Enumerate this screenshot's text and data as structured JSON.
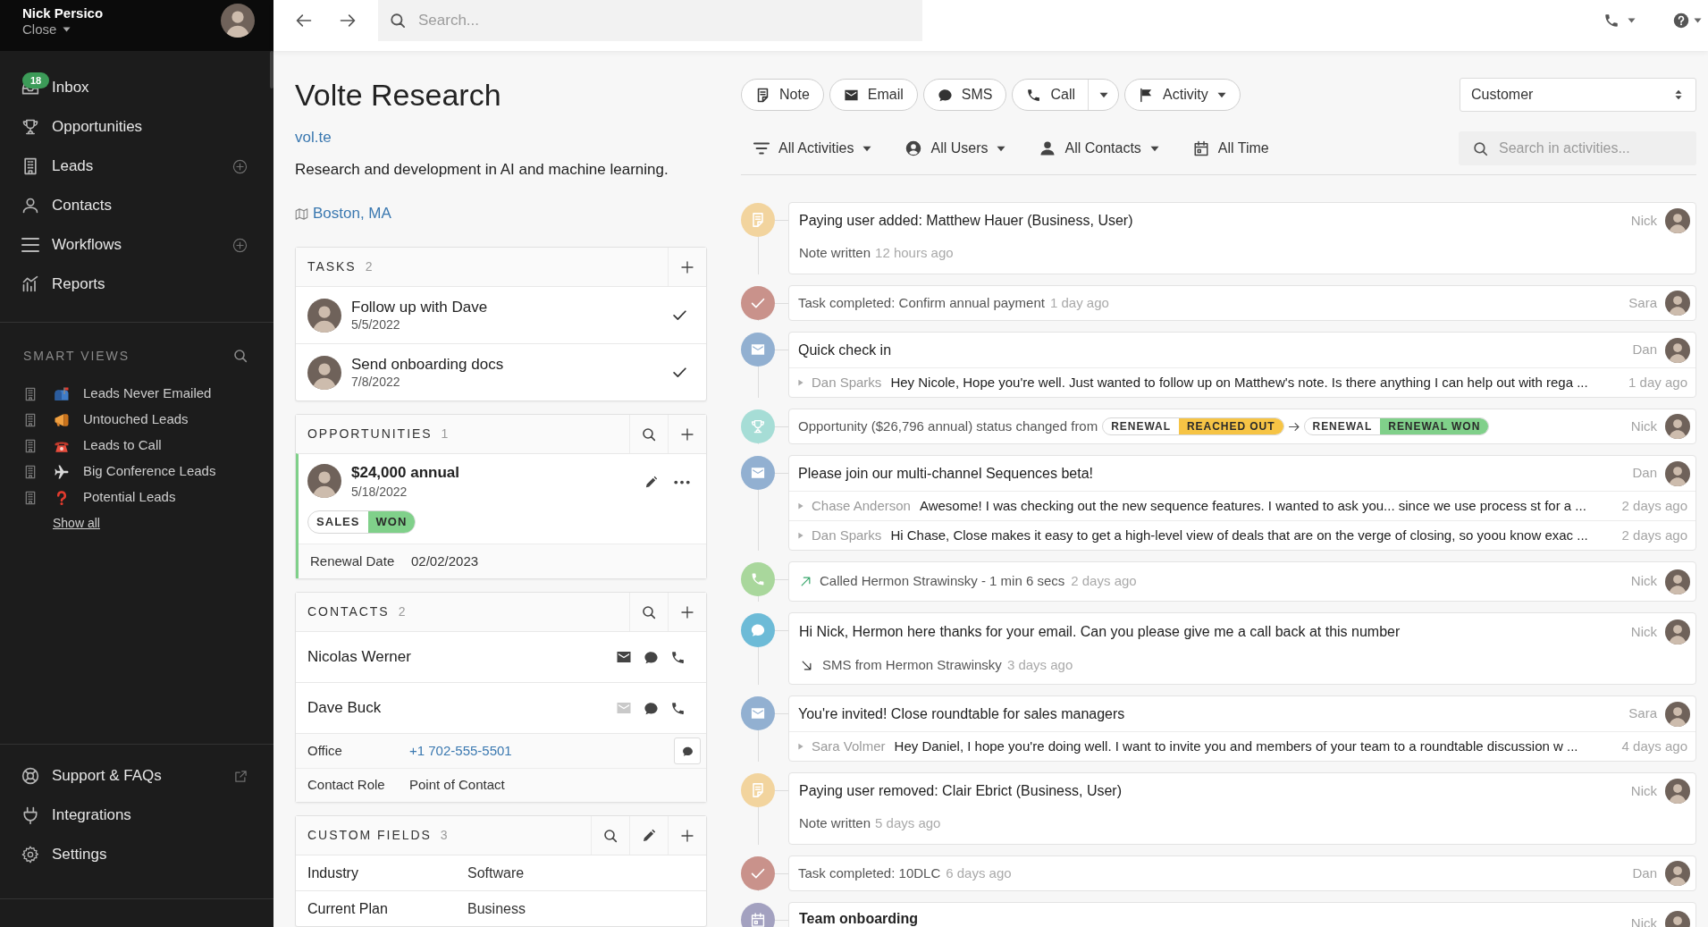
{
  "sidebar": {
    "user": {
      "name": "Nick Persico",
      "org": "Close"
    },
    "nav": [
      {
        "label": "Inbox",
        "kind": "inbox",
        "badge": "18",
        "has_add": false
      },
      {
        "label": "Opportunities",
        "kind": "trophy",
        "has_add": false
      },
      {
        "label": "Leads",
        "kind": "building",
        "has_add": true
      },
      {
        "label": "Contacts",
        "kind": "person",
        "has_add": false
      },
      {
        "label": "Workflows",
        "kind": "list",
        "has_add": true
      },
      {
        "label": "Reports",
        "kind": "chart",
        "has_add": false
      }
    ],
    "smart_views": {
      "title": "SMART VIEWS",
      "items": [
        {
          "label": "Leads Never Emailed",
          "kind": "mailbox"
        },
        {
          "label": "Untouched Leads",
          "kind": "megaphone"
        },
        {
          "label": "Leads to Call",
          "kind": "telephone"
        },
        {
          "label": "Big Conference Leads",
          "kind": "airplane"
        },
        {
          "label": "Potential Leads",
          "kind": "question"
        }
      ],
      "show_all": "Show all"
    },
    "footer": [
      {
        "label": "Support & FAQs",
        "kind": "lifebuoy",
        "external": true
      },
      {
        "label": "Integrations",
        "kind": "plug",
        "external": false
      },
      {
        "label": "Settings",
        "kind": "gear",
        "external": false
      }
    ]
  },
  "top_bar": {
    "search": {
      "placeholder": "Search..."
    }
  },
  "lead": {
    "name": "Volte Research",
    "url": "vol.te",
    "description": "Research and development in AI and machine learning.",
    "location": "Boston, MA"
  },
  "tasks": {
    "title": "TASKS",
    "count": "2",
    "actions": [
      {
        "kind": "add"
      }
    ],
    "items": [
      {
        "title": "Follow up with Dave",
        "date": "5/5/2022"
      },
      {
        "title": "Send onboarding docs",
        "date": "7/8/2022"
      }
    ]
  },
  "opportunities": {
    "title": "OPPORTUNITIES",
    "count": "1",
    "actions": [
      {
        "kind": "search"
      },
      {
        "kind": "add"
      }
    ],
    "items": [
      {
        "value": "$24,000 annual",
        "date": "5/18/2022",
        "pipeline": "SALES",
        "status": "WON",
        "color": "#80d08a",
        "fields": [
          {
            "label": "Renewal Date",
            "value": "02/02/2023"
          }
        ]
      }
    ]
  },
  "contacts": {
    "title": "CONTACTS",
    "count": "2",
    "actions": [
      {
        "kind": "search"
      },
      {
        "kind": "add"
      }
    ],
    "items": [
      {
        "name": "Nicolas Werner",
        "has_email": true
      },
      {
        "name": "Dave Buck",
        "has_email": false,
        "details": [
          {
            "label": "Office",
            "value": "+1 702-555-5501",
            "kind": "phone"
          },
          {
            "label": "Contact Role",
            "value": "Point of Contact",
            "kind": "text"
          }
        ]
      }
    ]
  },
  "custom_fields": {
    "title": "CUSTOM FIELDS",
    "count": "3",
    "actions": [
      {
        "kind": "search"
      },
      {
        "kind": "edit"
      },
      {
        "kind": "add"
      }
    ],
    "items": [
      {
        "label": "Industry",
        "value": "Software"
      },
      {
        "label": "Current Plan",
        "value": "Business"
      }
    ]
  },
  "composer": [
    {
      "label": "Note",
      "kind": "note"
    },
    {
      "label": "Email",
      "kind": "email"
    },
    {
      "label": "SMS",
      "kind": "sms"
    },
    {
      "label": "Call",
      "kind": "call",
      "menu": {
        "kind": "split"
      }
    },
    {
      "label": "Activity",
      "kind": "flag",
      "menu": {
        "kind": "inline"
      }
    }
  ],
  "lead_status": {
    "value": "Customer"
  },
  "filters": [
    {
      "label": "All Activities",
      "kind": "filter",
      "caret": true
    },
    {
      "label": "All Users",
      "kind": "user",
      "caret": true
    },
    {
      "label": "All Contacts",
      "kind": "person",
      "caret": true
    },
    {
      "label": "All Time",
      "kind": "calendar",
      "caret": false
    }
  ],
  "activity_search": {
    "placeholder": "Search in activities..."
  },
  "activities": [
    {
      "kind": "note",
      "title": "Paying user added: Matthew Hauer (Business, User)",
      "subtitle": "Note written",
      "time": "12 hours ago",
      "user": "Nick"
    },
    {
      "kind": "task",
      "title": "Task completed: Confirm annual payment",
      "time": "1 day ago",
      "user": "Sara"
    },
    {
      "kind": "email",
      "title": "Quick check in",
      "user": "Dan",
      "messages": [
        {
          "sender": "Dan Sparks",
          "text": "Hey Nicole, Hope you're well. Just wanted to follow up on Matthew's note. Is there anything I can help out with rega ...",
          "time": "1 day ago"
        }
      ]
    },
    {
      "kind": "opportunity",
      "title": "Opportunity ($26,796 annual) status changed from",
      "from": {
        "pipeline": "RENEWAL",
        "status": "REACHED OUT",
        "color": "#f6c445"
      },
      "to": {
        "pipeline": "RENEWAL",
        "status": "RENEWAL WON",
        "color": "#80d08a"
      },
      "user": "Nick"
    },
    {
      "kind": "email",
      "title": "Please join our multi-channel Sequences beta!",
      "user": "Dan",
      "messages": [
        {
          "sender": "Chase Anderson",
          "text": "Awesome! I was checking out the new sequence features. I wanted to ask you... since we use process st for a ...",
          "time": "2 days ago"
        },
        {
          "sender": "Dan Sparks",
          "text": "Hi Chase, Close makes it easy to get a high-level view of deals that are on the verge of closing, so yoou know exac ...",
          "time": "2 days ago"
        }
      ]
    },
    {
      "kind": "call",
      "outgoing": true,
      "title": "Called Hermon Strawinsky - 1 min 6 secs",
      "time": "2 days ago",
      "user": "Nick"
    },
    {
      "kind": "sms",
      "outgoing": false,
      "title": "Hi Nick, Hermon here thanks for your email. Can you please give me a call back at this number",
      "subtitle": "SMS from Hermon Strawinsky",
      "time": "3 days ago",
      "user": "Nick"
    },
    {
      "kind": "email",
      "title": "You're invited! Close roundtable for sales managers",
      "user": "Sara",
      "messages": [
        {
          "sender": "Sara Volmer",
          "text": "Hey Daniel, I hope you're doing well. I want to invite you and members of your team to a roundtable discussion w ...",
          "time": "4 days ago"
        }
      ]
    },
    {
      "kind": "note",
      "title": "Paying user removed: Clair Ebrict (Business, User)",
      "subtitle": "Note written",
      "time": "5 days ago",
      "user": "Nick"
    },
    {
      "kind": "task",
      "title": "Task completed: 10DLC",
      "time": "6 days ago",
      "user": "Dan"
    },
    {
      "kind": "meeting",
      "title": "Team onboarding",
      "user": "Nick"
    }
  ]
}
